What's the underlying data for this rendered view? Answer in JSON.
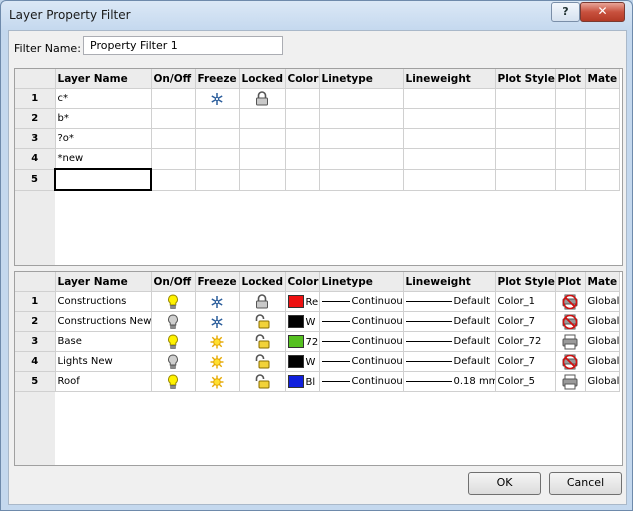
{
  "window": {
    "title": "Layer Property Filter",
    "help_label": "?",
    "close_label": "✕"
  },
  "filter_name": {
    "label": "Filter Name:",
    "value": "Property Filter 1"
  },
  "columns": [
    "Layer Name",
    "On/Off",
    "Freeze",
    "Locked",
    "Color",
    "Linetype",
    "Lineweight",
    "Plot Style",
    "Plot",
    "Mate"
  ],
  "filter_rows": [
    {
      "num": "1",
      "name": "c*",
      "freeze": true,
      "locked": true
    },
    {
      "num": "2",
      "name": "b*",
      "freeze": false,
      "locked": false
    },
    {
      "num": "3",
      "name": "?o*",
      "freeze": false,
      "locked": false
    },
    {
      "num": "4",
      "name": "*new",
      "freeze": false,
      "locked": false
    },
    {
      "num": "5",
      "name": "",
      "freeze": false,
      "locked": false
    }
  ],
  "preview_rows": [
    {
      "num": "1",
      "name": "Constructions",
      "on": true,
      "freeze": "frozen",
      "locked": true,
      "color_hex": "#ee1111",
      "color": "Re",
      "linetype": "Continuou",
      "lineweight": "Default",
      "plot_style": "Color_1",
      "plot": false,
      "material": "Global"
    },
    {
      "num": "2",
      "name": "Constructions New",
      "on": false,
      "freeze": "frozen",
      "locked": false,
      "color_hex": "#000000",
      "color": "W",
      "linetype": "Continuou",
      "lineweight": "Default",
      "plot_style": "Color_7",
      "plot": false,
      "material": "Global"
    },
    {
      "num": "3",
      "name": "Base",
      "on": true,
      "freeze": "thawed",
      "locked": false,
      "color_hex": "#55c020",
      "color": "72",
      "linetype": "Continuou",
      "lineweight": "Default",
      "plot_style": "Color_72",
      "plot": true,
      "material": "Global"
    },
    {
      "num": "4",
      "name": "Lights New",
      "on": false,
      "freeze": "thawed",
      "locked": false,
      "color_hex": "#000000",
      "color": "W",
      "linetype": "Continuou",
      "lineweight": "Default",
      "plot_style": "Color_7",
      "plot": false,
      "material": "Global"
    },
    {
      "num": "5",
      "name": "Roof",
      "on": true,
      "freeze": "thawed",
      "locked": false,
      "color_hex": "#1020dd",
      "color": "Bl",
      "linetype": "Continuou",
      "lineweight": "0.18 mm",
      "plot_style": "Color_5",
      "plot": true,
      "material": "Global"
    }
  ],
  "buttons": {
    "ok": "OK",
    "cancel": "Cancel"
  }
}
